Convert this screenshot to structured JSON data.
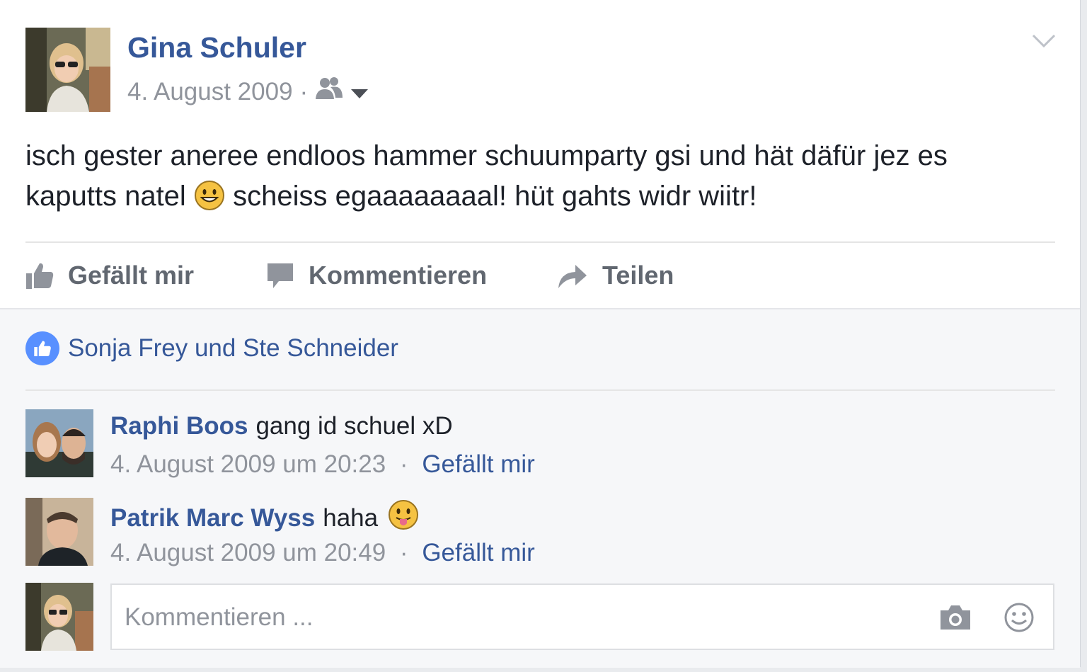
{
  "post": {
    "author": "Gina Schuler",
    "date": "4. August 2009",
    "separator": "·",
    "audience_icon": "friends-icon",
    "text_part1": "isch gester aneree endloos hammer schuumparty gsi und hät däfür jez es kaputts natel",
    "text_part2": "scheiss egaaaaaaaal! hüt gahts widr wiitr!"
  },
  "actions": {
    "like": "Gefällt mir",
    "comment": "Kommentieren",
    "share": "Teilen"
  },
  "likes": {
    "text": "Sonja Frey und Ste Schneider"
  },
  "comments": [
    {
      "name": "Raphi Boos",
      "text": "gang id schuel xD",
      "time": "4. August 2009 um 20:23",
      "separator": "·",
      "like": "Gefällt mir"
    },
    {
      "name": "Patrik Marc Wyss",
      "text": "haha",
      "time": "4. August 2009 um 20:49",
      "separator": "·",
      "like": "Gefällt mir"
    }
  ],
  "composer": {
    "placeholder": "Kommentieren ..."
  },
  "colors": {
    "link": "#365899",
    "meta": "#90949c",
    "like_badge": "#5890ff"
  }
}
